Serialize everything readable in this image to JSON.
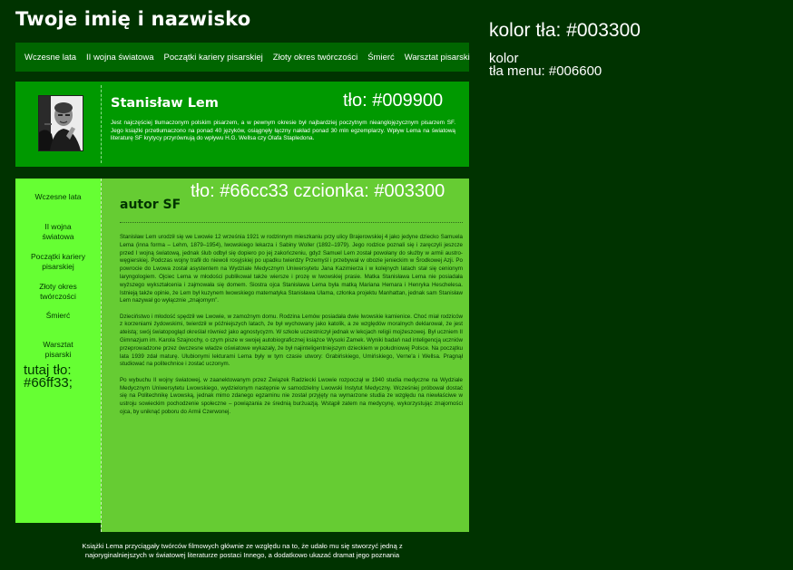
{
  "site_title": "Twoje imię i nazwisko",
  "notes": {
    "background": "kolor tła: #003300",
    "menu_line1": "kolor",
    "menu_line2": "tła menu: #006600"
  },
  "menu": {
    "items": [
      "Wczesne lata",
      "II wojna światowa",
      "Początki kariery pisarskiej",
      "Złoty okres twórczości",
      "Śmierć",
      "Warsztat pisarski"
    ]
  },
  "header": {
    "name": "Stanisław Lem",
    "label": "tło: #009900",
    "text": "Jest najczęściej tłumaczonym polskim pisarzem, a w pewnym okresie był najbardziej poczytnym nieanglojęzycznym pisarzem SF. Jego książki przetłumaczono na ponad 40 języków, osiągnęły łączny nakład ponad 30 mln egzemplarzy. Wpływ Lema na światową literaturę SF krytycy przyrównują do wpływu H.G. Wellsa czy Olafa Stapledona."
  },
  "sidebar": {
    "items": [
      {
        "line1": "Wczesne lata",
        "line2": ""
      },
      {
        "line1": "II wojna",
        "line2": "światowa"
      },
      {
        "line1": "Początki kariery",
        "line2": "pisarskiej"
      },
      {
        "line1": "Złoty okres",
        "line2": "twórczości"
      },
      {
        "line1": "Śmierć",
        "line2": ""
      },
      {
        "line1": "Warsztat",
        "line2": "pisarski"
      }
    ],
    "label_line1": "tutaj tło:",
    "label_line2": "#66ff33;"
  },
  "content": {
    "label": "tło: #66cc33 czcionka: #003300",
    "title": "autor SF",
    "paragraphs": [
      "Stanisław Lem urodził się we Lwowie 12 września 1921 w rodzinnym mieszkaniu przy ulicy Brajerowskiej 4 jako jedyne dziecko Samuela Lema (inna forma – Lehm, 1879–1954), lwowskiego lekarza i Sabiny Woller (1892–1979). Jego rodzice poznali się i zaręczyli jeszcze przed I wojną światową, jednak ślub odbył się dopiero po jej zakończeniu, gdyż Samuel Lem został powołany do służby w armii austro-węgierskiej. Podczas wojny trafił do niewoli rosyjskiej po upadku twierdzy Przemyśl i przebywał w obozie jenieckim w Środkowej Azji. Po powrocie do Lwowa został asystentem na Wydziale Medycznym Uniwersytetu Jana Kazimierza i w kolejnych latach stał się cenionym laryngologiem. Ojciec Lema w młodości publikował także wiersze i prozę w lwowskiej prasie. Matka Stanisława Lema nie posiadała wyższego wykształcenia i zajmowała się domem. Siostra ojca Stanisława Lema była matką Mariana Hemara i Henryka Heschelesa. Istnieją także opinie, że Lem był kuzynem lwowskiego matematyka Stanisława Ulama, członka projektu Manhattan, jednak sam Stanisław Lem nazywał go wyłącznie „znajomym”.",
      "Dzieciństwo i młodość spędził we Lwowie, w zamożnym domu. Rodzina Lemów posiadała dwie lwowskie kamienice. Choć miał rodziców z korzeniami żydowskimi, twierdził w późniejszych latach, że był wychowany jako katolik, a ze względów moralnych deklarował, że jest ateistą; swój światopogląd określał również jako agnostycyzm. W szkole uczestniczył jednak w lekcjach religii mojżeszowej. Był uczniem II Gimnazjum im. Karola Szajnochy, o czym pisze w swojej autobiograficznej książce Wysoki Zamek. Wyniki badań nad inteligencją uczniów przeprowadzone przez ówczesne władze oświatowe wykazały, że był najinteligentniejszym dzieckiem w południowej Polsce. Na początku lata 1939 zdał maturę. Ulubionymi lekturami Lema były w tym czasie utwory: Grabińskiego, Umińskiego, Verne'a i Wellsa. Pragnął studiować na politechnice i zostać uczonym.",
      "Po wybuchu II wojny światowej, w zaanektowanym przez Związek Radziecki Lwowie rozpoczął w 1940 studia medyczne na Wydziale Medycznym Uniwersytetu Lwowskiego, wydzielonym następnie w samodzielny Lwowski Instytut Medyczny. Wcześniej próbował dostać się na Politechnikę Lwowską, jednak mimo zdanego egzaminu nie został przyjęty na wymarzone studia ze względu na niewłaściwe w ustroju sowieckim pochodzenie społeczne – powiązania ze średnią burżuazją. Wstąpił zatem na medycynę, wykorzystując znajomości ojca, by uniknąć poboru do Armii Czerwonej."
    ]
  },
  "footer": {
    "line1": "Książki Lema przyciągały twórców filmowych głównie ze względu na to, że udało mu się stworzyć jedną z",
    "line2": "najoryginalniejszych w światowej literaturze postaci Innego, a dodatkowo ukazać dramat jego poznania"
  },
  "colors": {
    "page_bg": "#003300",
    "menu_bg": "#006600",
    "header_bg": "#009900",
    "sidebar_bg": "#66ff33",
    "content_bg": "#66cc33",
    "content_text": "#003300"
  }
}
